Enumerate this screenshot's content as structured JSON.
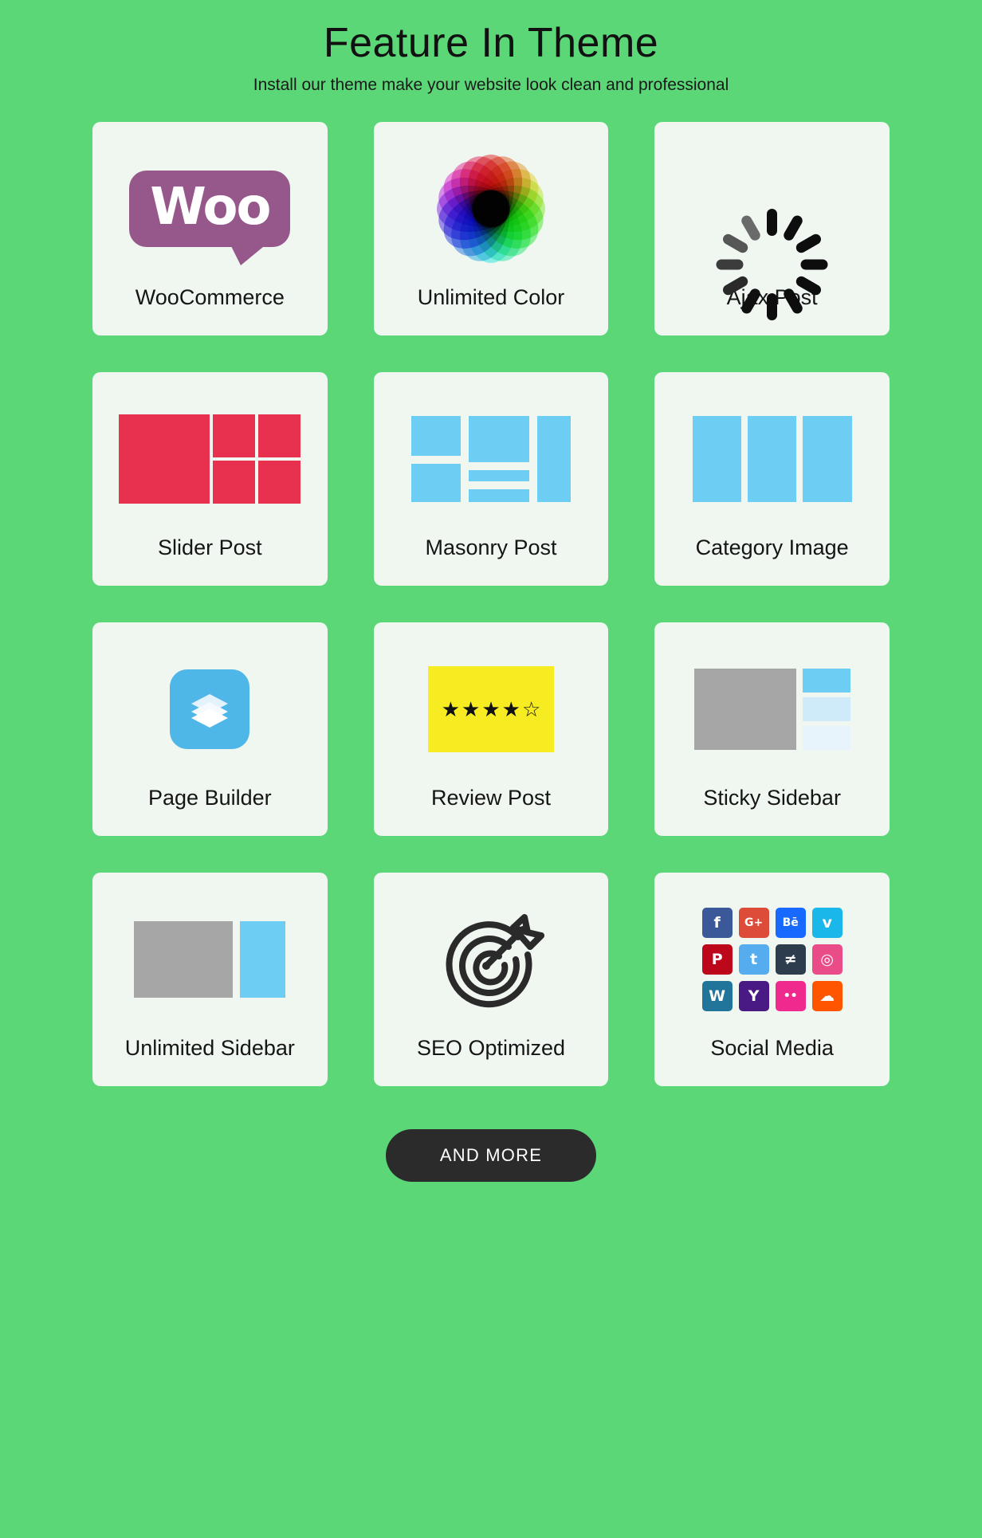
{
  "header": {
    "title": "Feature In Theme",
    "subtitle": "Install our theme make your website look clean and professional"
  },
  "colors": {
    "background": "#5BD778",
    "card": "#F0F7F1",
    "woo_purple": "#96588A",
    "slider_red": "#E8304F",
    "blue": "#6DCDF2",
    "gray": "#A6A6A6",
    "review_yellow": "#F6EC21",
    "button_dark": "#2B2B2B",
    "text_dark": "#151515"
  },
  "features": [
    {
      "label": "WooCommerce",
      "icon": "woocommerce-icon",
      "logo_text": "Woo"
    },
    {
      "label": "Unlimited Color",
      "icon": "color-wheel-icon"
    },
    {
      "label": "Ajax Post",
      "icon": "loading-spinner-icon"
    },
    {
      "label": "Slider Post",
      "icon": "slider-layout-icon"
    },
    {
      "label": "Masonry Post",
      "icon": "masonry-layout-icon"
    },
    {
      "label": "Category Image",
      "icon": "category-columns-icon"
    },
    {
      "label": "Page Builder",
      "icon": "layers-stack-icon"
    },
    {
      "label": "Review Post",
      "icon": "star-rating-icon",
      "stars_filled": 4,
      "stars_total": 5
    },
    {
      "label": "Sticky Sidebar",
      "icon": "sticky-sidebar-icon"
    },
    {
      "label": "Unlimited Sidebar",
      "icon": "unlimited-sidebar-icon"
    },
    {
      "label": "SEO Optimized",
      "icon": "target-arrow-icon"
    },
    {
      "label": "Social Media",
      "icon": "social-grid-icon"
    }
  ],
  "social_icons": [
    {
      "name": "facebook-icon",
      "glyph": "f",
      "color": "#3B5998"
    },
    {
      "name": "google-plus-icon",
      "glyph": "G+",
      "color": "#DD4B39"
    },
    {
      "name": "behance-icon",
      "glyph": "Bē",
      "color": "#1769FF"
    },
    {
      "name": "vimeo-icon",
      "glyph": "v",
      "color": "#1AB7EA"
    },
    {
      "name": "pinterest-icon",
      "glyph": "P",
      "color": "#BD081C"
    },
    {
      "name": "twitter-icon",
      "glyph": "t",
      "color": "#55ACEE"
    },
    {
      "name": "deviantart-icon",
      "glyph": "≠",
      "color": "#2E3D4E"
    },
    {
      "name": "dribbble-icon",
      "glyph": "◎",
      "color": "#EA4C89"
    },
    {
      "name": "wordpress-icon",
      "glyph": "W",
      "color": "#21759B"
    },
    {
      "name": "yahoo-icon",
      "glyph": "Y",
      "color": "#4A1A84"
    },
    {
      "name": "flickr-icon",
      "glyph": "••",
      "color": "#F0298F"
    },
    {
      "name": "soundcloud-icon",
      "glyph": "☁",
      "color": "#FF5500"
    }
  ],
  "button": {
    "label": "AND MORE"
  }
}
